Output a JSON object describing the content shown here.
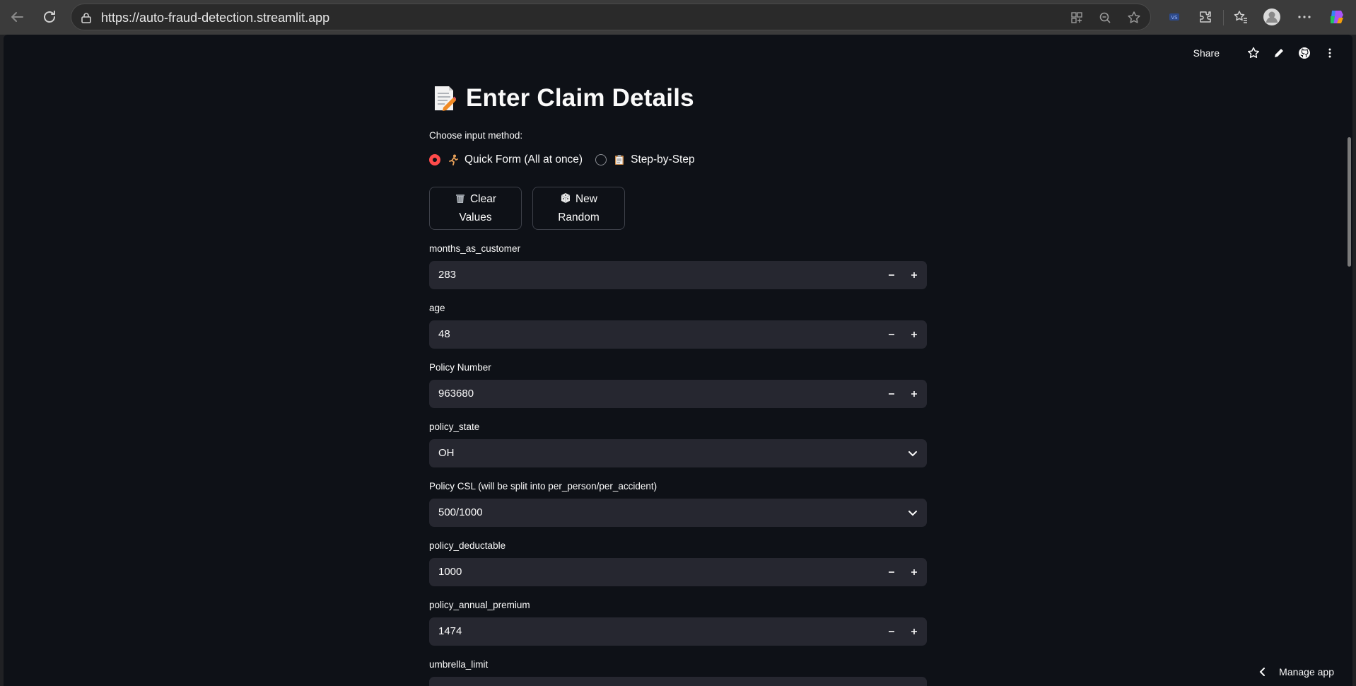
{
  "browser": {
    "url": "https://auto-fraud-detection.streamlit.app"
  },
  "header": {
    "share_label": "Share"
  },
  "page": {
    "title": "Enter Claim Details",
    "input_method_label": "Choose input method:",
    "radio_options": [
      {
        "label": "Quick Form (All at once)",
        "selected": true
      },
      {
        "label": "Step-by-Step",
        "selected": false
      }
    ],
    "buttons": {
      "clear_line1": "Clear",
      "clear_line2": "Values",
      "random_line1": "New",
      "random_line2": "Random"
    },
    "fields": [
      {
        "label": "months_as_customer",
        "value": "283",
        "kind": "number"
      },
      {
        "label": "age",
        "value": "48",
        "kind": "number"
      },
      {
        "label": "Policy Number",
        "value": "963680",
        "kind": "number"
      },
      {
        "label": "policy_state",
        "value": "OH",
        "kind": "select"
      },
      {
        "label": "Policy CSL (will be split into per_person/per_accident)",
        "value": "500/1000",
        "kind": "select"
      },
      {
        "label": "policy_deductable",
        "value": "1000",
        "kind": "number"
      },
      {
        "label": "policy_annual_premium",
        "value": "1474",
        "kind": "number"
      },
      {
        "label": "umbrella_limit",
        "value": "",
        "kind": "number"
      }
    ]
  },
  "footer": {
    "manage_label": "Manage app"
  },
  "colors": {
    "accent": "#ff4b4b",
    "background": "#0e1117",
    "input_bg": "#262730",
    "text": "#fafafa"
  }
}
